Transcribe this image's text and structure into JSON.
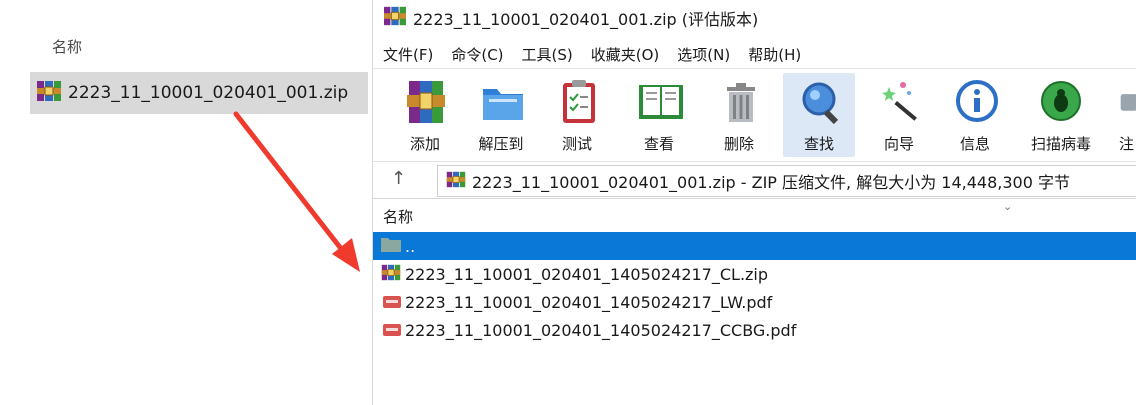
{
  "explorer": {
    "column_header": "名称",
    "file_name": "2223_11_10001_020401_001.zip"
  },
  "winrar": {
    "title": "2223_11_10001_020401_001.zip (评估版本)",
    "menus": [
      "文件(F)",
      "命令(C)",
      "工具(S)",
      "收藏夹(O)",
      "选项(N)",
      "帮助(H)"
    ],
    "tools": [
      {
        "label": "添加",
        "icon": "add-archive-icon"
      },
      {
        "label": "解压到",
        "icon": "extract-folder-icon"
      },
      {
        "label": "测试",
        "icon": "test-clipboard-icon"
      },
      {
        "label": "查看",
        "icon": "view-book-icon"
      },
      {
        "label": "删除",
        "icon": "trash-icon"
      },
      {
        "label": "查找",
        "icon": "magnifier-icon"
      },
      {
        "label": "向导",
        "icon": "wizard-wand-icon"
      },
      {
        "label": "信息",
        "icon": "info-icon"
      },
      {
        "label": "扫描病毒",
        "icon": "virus-scan-icon"
      },
      {
        "label": "注",
        "icon": "comment-icon"
      }
    ],
    "address_text": "2223_11_10001_020401_001.zip - ZIP 压缩文件, 解包大小为 14,448,300 字节",
    "list_header": "名称",
    "rows": [
      {
        "name": "..",
        "type": "parent-folder"
      },
      {
        "name": "2223_11_10001_020401_1405024217_CL.zip",
        "type": "zip"
      },
      {
        "name": "2223_11_10001_020401_1405024217_LW.pdf",
        "type": "pdf"
      },
      {
        "name": "2223_11_10001_020401_1405024217_CCBG.pdf",
        "type": "pdf"
      }
    ]
  },
  "colors": {
    "selection": "#0a78d7",
    "arrow": "#f03a2e",
    "explorer_selection": "#d9d9d9"
  }
}
